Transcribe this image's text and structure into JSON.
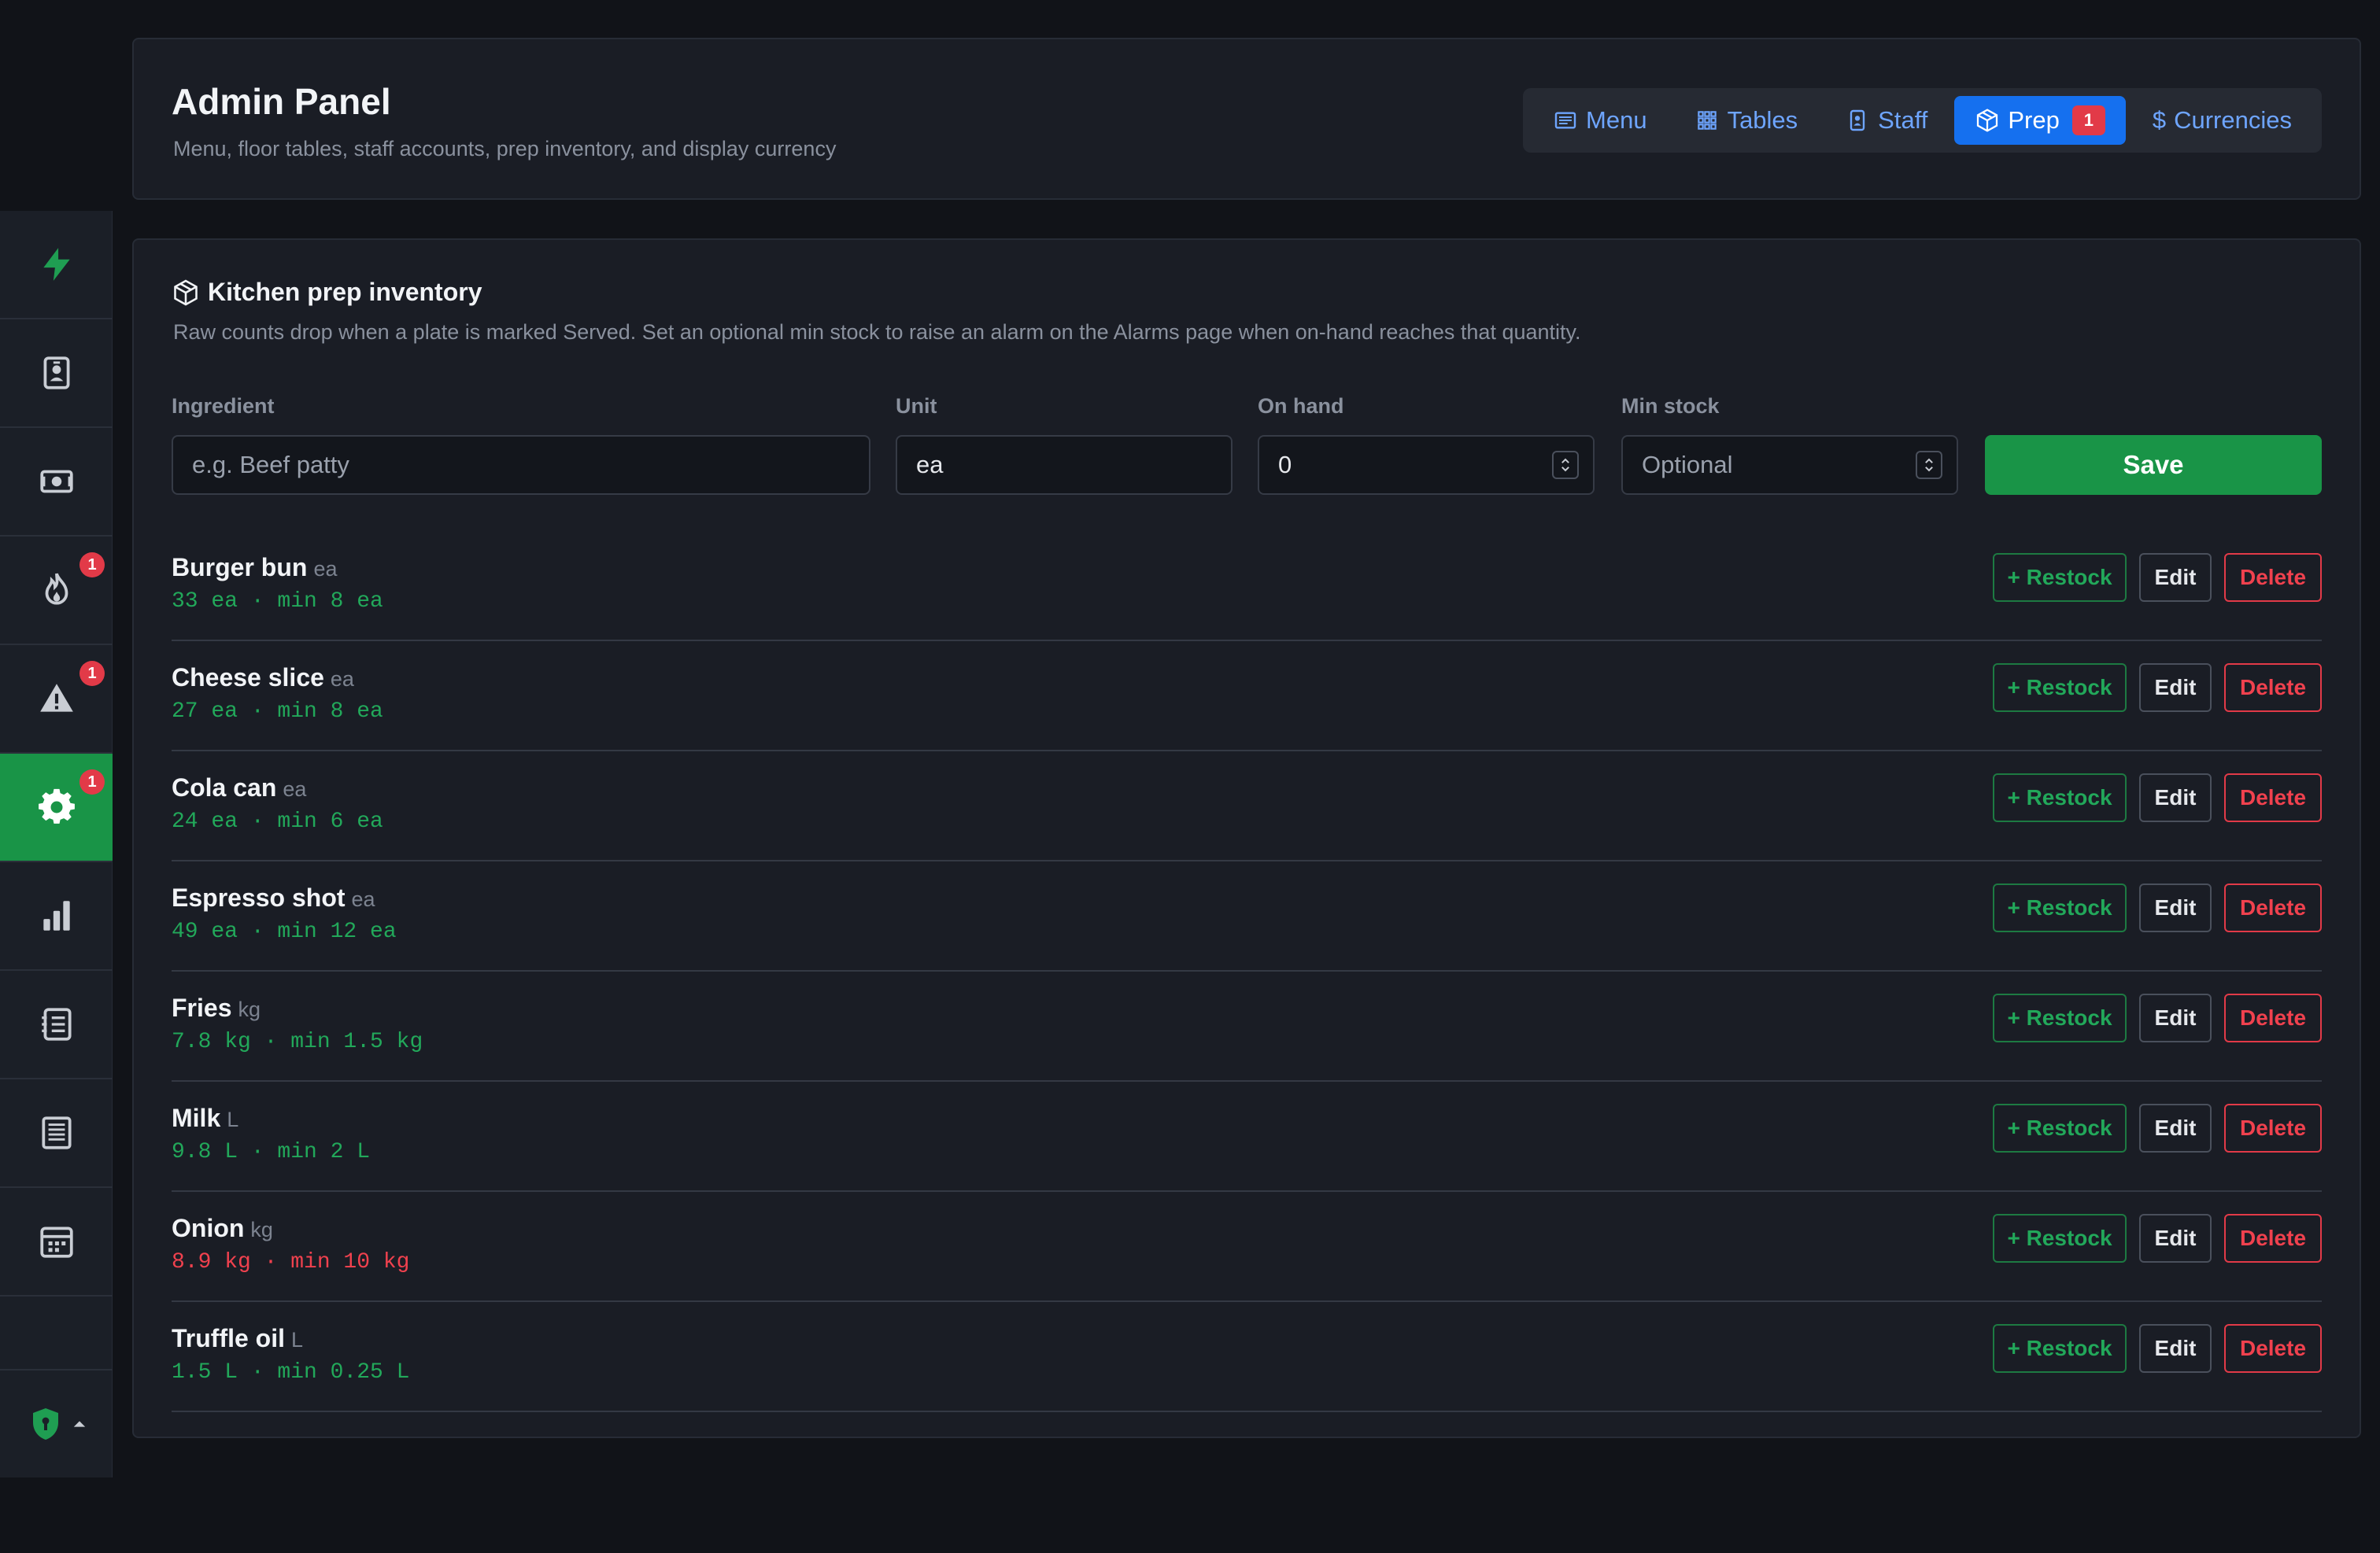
{
  "header": {
    "title": "Admin Panel",
    "subtitle": "Menu, floor tables, staff accounts, prep inventory, and display currency",
    "tabs": [
      {
        "label": "Menu",
        "icon": "list-icon"
      },
      {
        "label": "Tables",
        "icon": "grid-icon"
      },
      {
        "label": "Staff",
        "icon": "badge-icon"
      },
      {
        "label": "Prep",
        "icon": "box-icon",
        "badge": "1",
        "active": true
      },
      {
        "label": "Currencies",
        "icon": "dollar-icon"
      }
    ]
  },
  "sidebar": {
    "items": [
      {
        "icon": "bolt-icon"
      },
      {
        "icon": "id-card-icon"
      },
      {
        "icon": "cash-icon"
      },
      {
        "icon": "fire-icon",
        "badge": "1"
      },
      {
        "icon": "warning-icon",
        "badge": "1"
      },
      {
        "icon": "gear-icon",
        "badge": "1",
        "active": true
      },
      {
        "icon": "bar-chart-icon"
      },
      {
        "icon": "ledger-icon"
      },
      {
        "icon": "receipt-icon"
      },
      {
        "icon": "calendar-icon"
      }
    ],
    "bottom_icon": "shield-icon"
  },
  "inventory": {
    "title": "Kitchen prep inventory",
    "description": "Raw counts drop when a plate is marked Served. Set an optional min stock to raise an alarm on the Alarms page when on-hand reaches that quantity.",
    "form": {
      "ingredient_label": "Ingredient",
      "ingredient_placeholder": "e.g. Beef patty",
      "unit_label": "Unit",
      "unit_value": "ea",
      "onhand_label": "On hand",
      "onhand_value": "0",
      "minstock_label": "Min stock",
      "minstock_placeholder": "Optional",
      "save_label": "Save"
    },
    "actions": {
      "restock": "+ Restock",
      "edit": "Edit",
      "delete": "Delete"
    },
    "items": [
      {
        "name": "Burger bun",
        "unit": "ea",
        "stock": "33 ea · min 8 ea",
        "low": false
      },
      {
        "name": "Cheese slice",
        "unit": "ea",
        "stock": "27 ea · min 8 ea",
        "low": false
      },
      {
        "name": "Cola can",
        "unit": "ea",
        "stock": "24 ea · min 6 ea",
        "low": false
      },
      {
        "name": "Espresso shot",
        "unit": "ea",
        "stock": "49 ea · min 12 ea",
        "low": false
      },
      {
        "name": "Fries",
        "unit": "kg",
        "stock": "7.8 kg · min 1.5 kg",
        "low": false
      },
      {
        "name": "Milk",
        "unit": "L",
        "stock": "9.8 L · min 2 L",
        "low": false
      },
      {
        "name": "Onion",
        "unit": "kg",
        "stock": "8.9 kg · min 10 kg",
        "low": true
      },
      {
        "name": "Truffle oil",
        "unit": "L",
        "stock": "1.5 L · min 0.25 L",
        "low": false
      }
    ]
  },
  "colors": {
    "accent_green": "#199447",
    "accent_blue": "#1570ef",
    "danger_red": "#e23a48",
    "background": "#111318",
    "card": "#1a1d25"
  }
}
